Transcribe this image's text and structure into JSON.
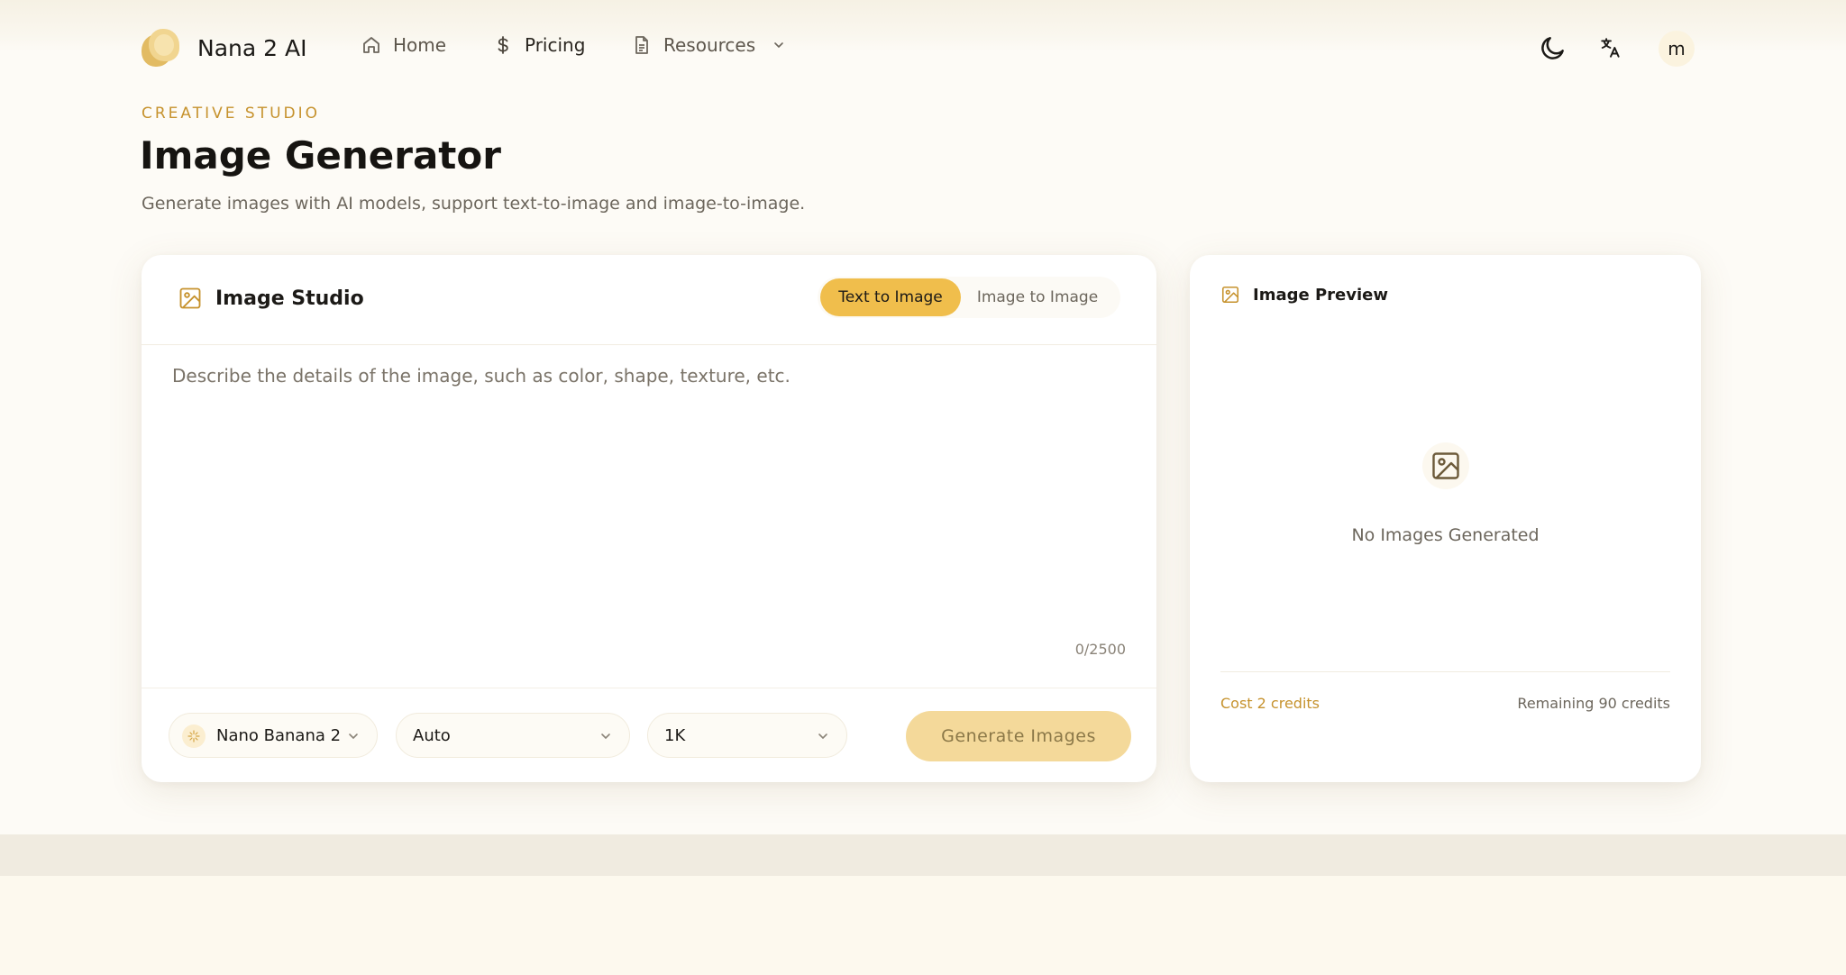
{
  "brand": {
    "name": "Nana 2 AI"
  },
  "nav": {
    "home": "Home",
    "pricing": "Pricing",
    "resources": "Resources",
    "avatar_initial": "m"
  },
  "header": {
    "eyebrow": "CREATIVE STUDIO",
    "title": "Image Generator",
    "subtitle": "Generate images with AI models, support text-to-image and image-to-image."
  },
  "studio": {
    "title": "Image Studio",
    "modes": [
      "Text to Image",
      "Image to Image"
    ],
    "active_mode": "Text to Image",
    "prompt_placeholder": "Describe the details of the image, such as color, shape, texture, etc.",
    "prompt_value": "",
    "counter": "0/2500",
    "model": "Nano Banana 2",
    "aspect_ratio": "Auto",
    "resolution": "1K",
    "generate_label": "Generate Images"
  },
  "preview": {
    "title": "Image Preview",
    "empty_text": "No Images Generated",
    "cost": "Cost 2 credits",
    "remaining": "Remaining 90 credits"
  },
  "colors": {
    "accent": "#f0be4c",
    "accent_text": "#c6922d",
    "background": "#fdfbf6"
  }
}
